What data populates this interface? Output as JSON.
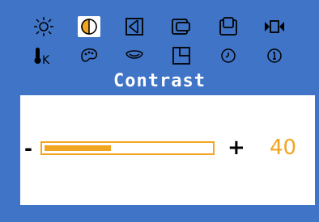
{
  "osd": {
    "title": "Contrast",
    "icons": [
      {
        "name": "brightness-icon",
        "selected": false
      },
      {
        "name": "contrast-icon",
        "selected": true
      },
      {
        "name": "h-size-icon",
        "selected": false
      },
      {
        "name": "h-position-icon",
        "selected": false
      },
      {
        "name": "v-position-icon",
        "selected": false
      },
      {
        "name": "video-icon",
        "selected": false
      },
      {
        "name": "color-temperature-icon",
        "selected": false,
        "label": "K"
      },
      {
        "name": "color-palette-icon",
        "selected": false
      },
      {
        "name": "smile-icon",
        "selected": false
      },
      {
        "name": "window-corner-icon",
        "selected": false
      },
      {
        "name": "timer-icon",
        "selected": false
      },
      {
        "name": "info-icon",
        "selected": false
      }
    ],
    "slider": {
      "minus_label": "-",
      "plus_label": "+",
      "value": "40",
      "fraction": 0.4
    },
    "colors": {
      "background": "#3f74c6",
      "accent": "#f2a521",
      "panel": "#ffffff"
    }
  }
}
